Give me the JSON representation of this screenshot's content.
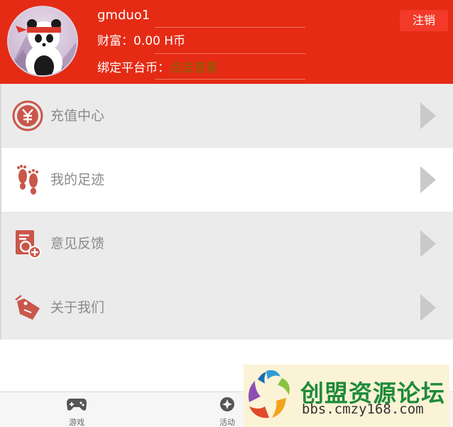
{
  "header": {
    "username": "gmduo1",
    "wealth_text": "财富：0.00 H币",
    "bind_label": "绑定平台币：",
    "bind_link": "点击查看",
    "logout_label": "注销"
  },
  "menu": [
    {
      "label": "充值中心",
      "icon": "yuan-icon"
    },
    {
      "label": "我的足迹",
      "icon": "footprint-icon"
    },
    {
      "label": "意见反馈",
      "icon": "feedback-icon"
    },
    {
      "label": "关于我们",
      "icon": "about-icon"
    }
  ],
  "tabbar": {
    "tabs": [
      {
        "label": "游戏",
        "icon": "gamepad-icon"
      },
      {
        "label": "活动",
        "icon": "activity-icon"
      }
    ]
  },
  "watermark": {
    "title": "创盟资源论坛",
    "url": "bbs.cmzy168.com"
  },
  "colors": {
    "header_red": "#e52b14",
    "icon_red": "#c9574a",
    "link_olive": "#7a6a00",
    "row_gray": "#ebebeb"
  }
}
